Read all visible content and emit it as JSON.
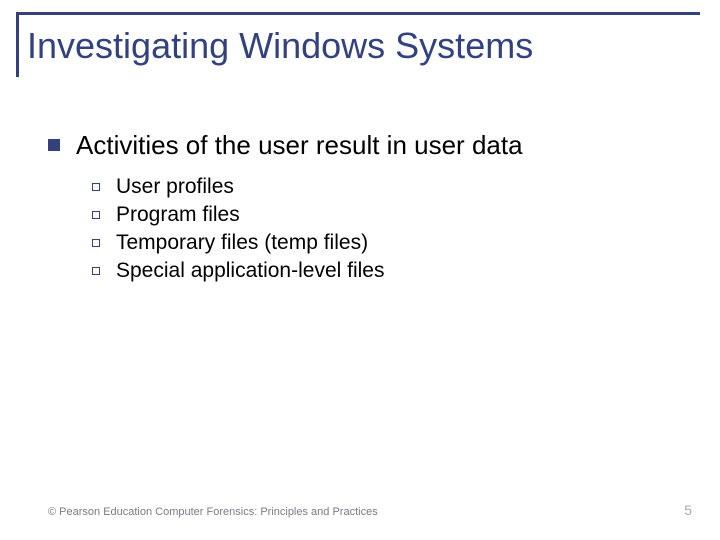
{
  "title": "Investigating Windows Systems",
  "body": {
    "item": "Activities of the user result in user data",
    "subitems": [
      "User profiles",
      "Program files",
      "Temporary files (temp files)",
      "Special application-level files"
    ]
  },
  "footer": {
    "copyright": "© Pearson Education  Computer Forensics: Principles and Practices",
    "page": "5"
  }
}
